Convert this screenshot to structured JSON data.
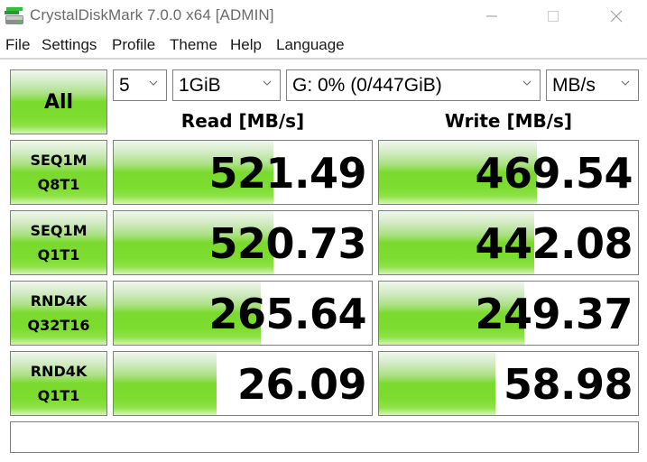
{
  "window": {
    "title": "CrystalDiskMark 7.0.0 x64 [ADMIN]",
    "controls": [
      "minimize",
      "maximize",
      "close"
    ]
  },
  "menu": [
    "File",
    "Settings",
    "Profile",
    "Theme",
    "Help",
    "Language"
  ],
  "toolbar": {
    "all_label": "All",
    "count": "5",
    "size": "1GiB",
    "drive": "G: 0% (0/447GiB)",
    "unit": "MB/s"
  },
  "headers": {
    "read": "Read [MB/s]",
    "write": "Write [MB/s]"
  },
  "tests": [
    {
      "line1": "SEQ1M",
      "line2": "Q8T1",
      "read": "521.49",
      "write": "469.54",
      "read_level": 0.62,
      "write_level": 0.61
    },
    {
      "line1": "SEQ1M",
      "line2": "Q1T1",
      "read": "520.73",
      "write": "442.08",
      "read_level": 0.62,
      "write_level": 0.6
    },
    {
      "line1": "RND4K",
      "line2": "Q32T16",
      "read": "265.64",
      "write": "249.37",
      "read_level": 0.57,
      "write_level": 0.56
    },
    {
      "line1": "RND4K",
      "line2": "Q1T1",
      "read": "26.09",
      "write": "58.98",
      "read_level": 0.4,
      "write_level": 0.45
    }
  ],
  "status": "",
  "colors": {
    "accent_green": "#7ada2e",
    "border": "#808080"
  }
}
